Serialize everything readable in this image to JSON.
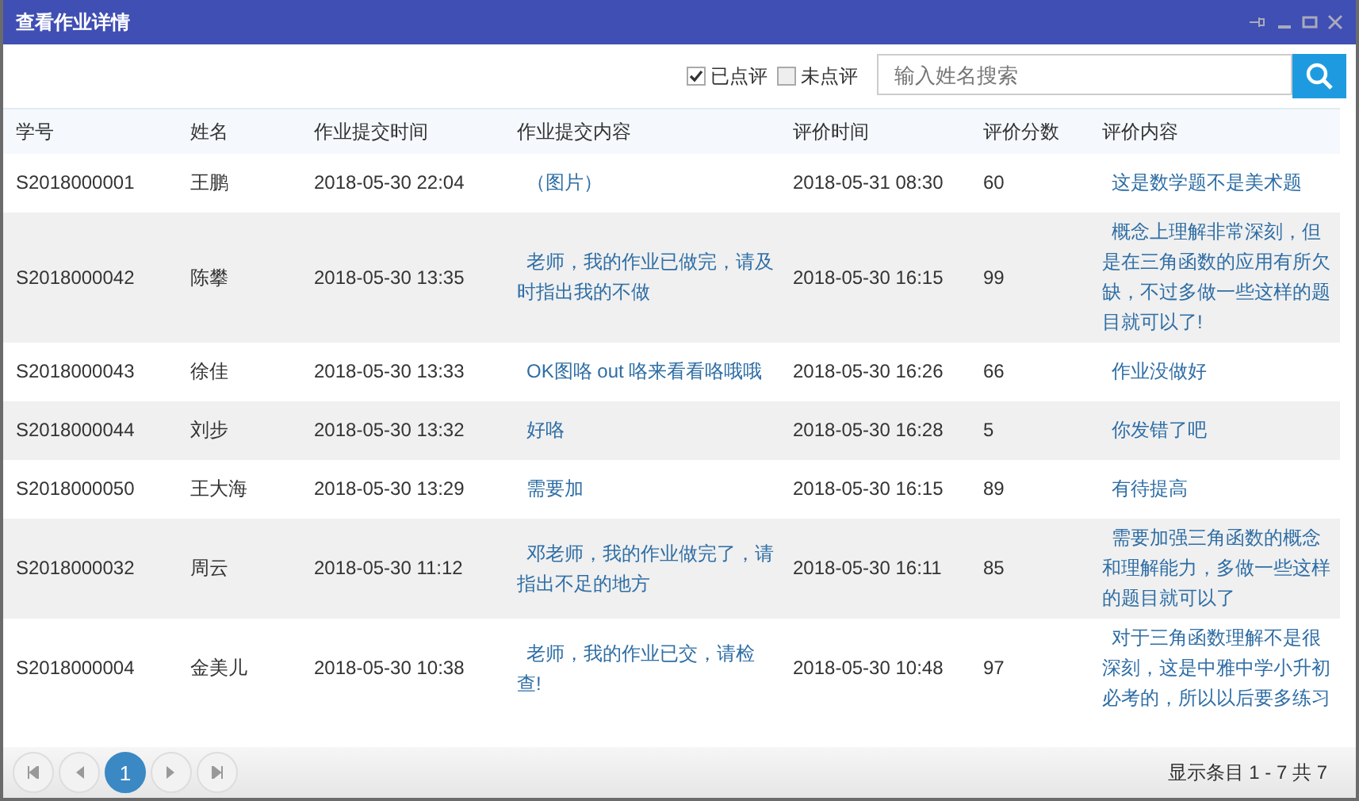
{
  "window": {
    "title": "查看作业详情"
  },
  "filters": [
    {
      "label": "已点评",
      "checked": true
    },
    {
      "label": "未点评",
      "checked": false
    }
  ],
  "search": {
    "placeholder": "输入姓名搜索"
  },
  "table": {
    "columns": [
      "学号",
      "姓名",
      "作业提交时间",
      "作业提交内容",
      "评价时间",
      "评价分数",
      "评价内容"
    ],
    "rows": [
      [
        "S2018000001",
        "王鹏",
        "2018-05-30 22:04",
        "（图片）",
        "2018-05-31 08:30",
        "60",
        "这是数学题不是美术题"
      ],
      [
        "S2018000042",
        "陈攀",
        "2018-05-30 13:35",
        "老师，我的作业已做完，请及时指出我的不做",
        "2018-05-30 16:15",
        "99",
        "概念上理解非常深刻，但是在三角函数的应用有所欠缺，不过多做一些这样的题目就可以了!"
      ],
      [
        "S2018000043",
        "徐佳",
        "2018-05-30 13:33",
        "OK图咯 out 咯来看看咯哦哦",
        "2018-05-30 16:26",
        "66",
        "作业没做好"
      ],
      [
        "S2018000044",
        "刘步",
        "2018-05-30 13:32",
        "好咯",
        "2018-05-30 16:28",
        "5",
        "你发错了吧"
      ],
      [
        "S2018000050",
        "王大海",
        "2018-05-30 13:29",
        "需要加",
        "2018-05-30 16:15",
        "89",
        "有待提高"
      ],
      [
        "S2018000032",
        "周云",
        "2018-05-30 11:12",
        "邓老师，我的作业做完了，请指出不足的地方",
        "2018-05-30 16:11",
        "85",
        "需要加强三角函数的概念和理解能力，多做一些这样的题目就可以了"
      ],
      [
        "S2018000004",
        "金美儿",
        "2018-05-30 10:38",
        "老师，我的作业已交，请检查!",
        "2018-05-30 10:48",
        "97",
        "对于三角函数理解不是很深刻，这是中雅中学小升初必考的，所以以后要多练习"
      ]
    ]
  },
  "pager": {
    "pages": [
      {
        "label": "1",
        "selected": true
      }
    ],
    "summary": "显示条目 1 - 7 共 7"
  }
}
